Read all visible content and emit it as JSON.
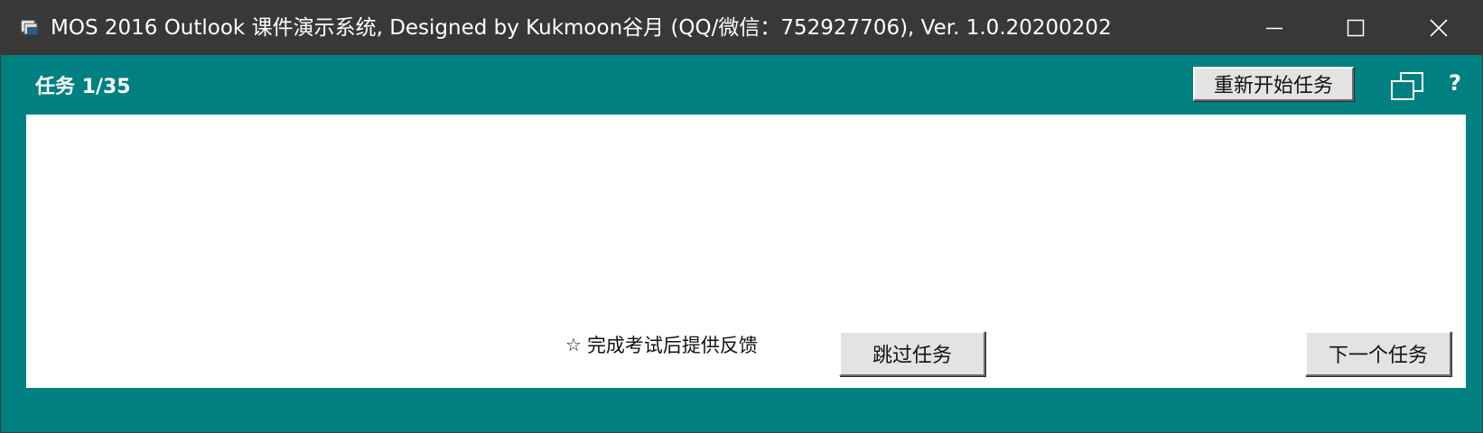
{
  "window": {
    "title": "MOS 2016 Outlook 课件演示系统, Designed by Kukmoon谷月 (QQ/微信：752927706), Ver. 1.0.20200202",
    "controls": {
      "minimize_icon": "minimize-icon",
      "maximize_icon": "maximize-icon",
      "close_icon": "close-icon"
    },
    "app_icon": "app-icon",
    "colors": {
      "titlebar": "#383838",
      "background": "#008080",
      "panel": "#ffffff",
      "button": "#e3e3e3"
    }
  },
  "header": {
    "task_label": "任务 1/35",
    "restart_button": "重新开始任务",
    "restore_icon": "restore-window-icon",
    "help_label": "?"
  },
  "panel": {
    "feedback_star": "☆",
    "feedback_text": "完成考试后提供反馈",
    "skip_button": "跳过任务",
    "next_button": "下一个任务"
  }
}
